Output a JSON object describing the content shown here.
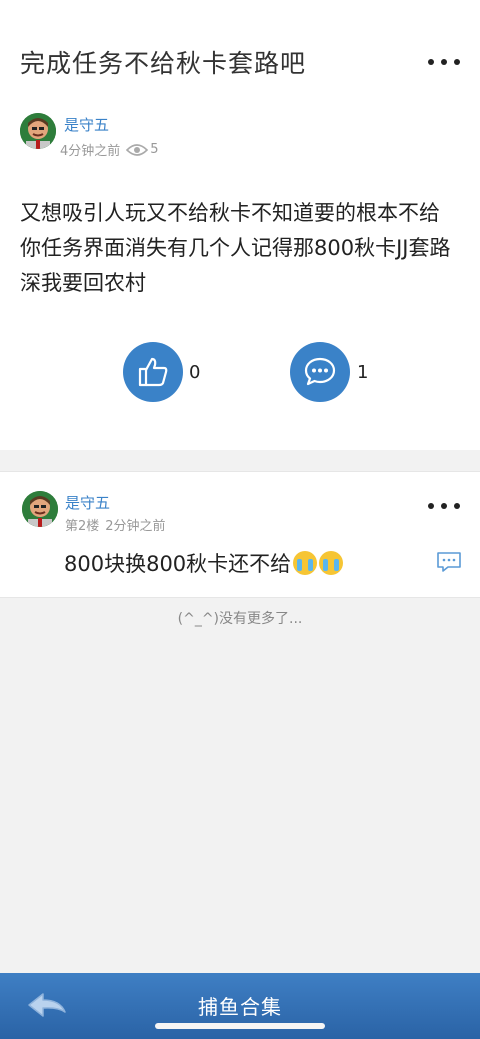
{
  "post": {
    "title": "完成任务不给秋卡套路吧",
    "author": "是守五",
    "time": "4分钟之前",
    "views": "5",
    "body": "又想吸引人玩又不给秋卡不知道要的根本不给你任务界面消失有几个人记得那800秋卡JJ套路深我要回农村",
    "likes": "0",
    "comments": "1"
  },
  "reply": {
    "author": "是守五",
    "floor": "第2楼",
    "time": "2分钟之前",
    "text": "800块换800秋卡还不给"
  },
  "footer": {
    "no_more": "(^_^)没有更多了..."
  },
  "bottom_bar": {
    "title": "捕鱼合集"
  },
  "colors": {
    "accent": "#3a82c8",
    "bar": "#2a63a6"
  },
  "icons": [
    "more-icon",
    "eye-icon",
    "thumbs-up-icon",
    "comment-icon",
    "reply-icon",
    "back-arrow-icon",
    "crying-emoji-icon"
  ]
}
